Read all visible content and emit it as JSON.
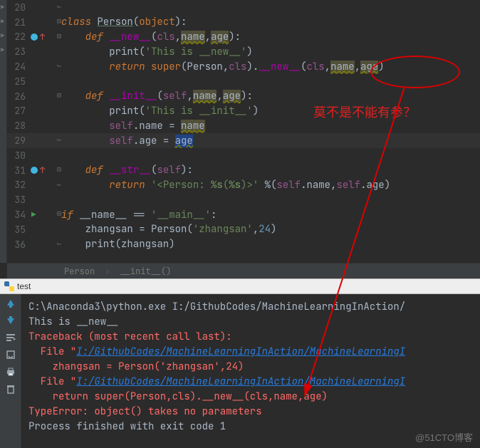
{
  "editor": {
    "lines": [
      {
        "n": 20,
        "gutter": {
          "fold": "end",
          "at": 38
        },
        "segs": []
      },
      {
        "n": 21,
        "gutter": {
          "fold": "start",
          "at": 38
        },
        "segs": [
          {
            "t": "class ",
            "c": "kw"
          },
          {
            "t": "Person",
            "c": "cls"
          },
          {
            "t": "(",
            "c": "op"
          },
          {
            "t": "object",
            "c": "kw2"
          },
          {
            "t": "):",
            "c": "op"
          }
        ]
      },
      {
        "n": 22,
        "gutter": {
          "circle": true,
          "arrowUp": true,
          "fold": "start",
          "at": 38
        },
        "segs": [
          {
            "t": "    ",
            "c": ""
          },
          {
            "t": "def ",
            "c": "kw"
          },
          {
            "t": "__new__",
            "c": "fnmagic"
          },
          {
            "t": "(",
            "c": "op"
          },
          {
            "t": "cls",
            "c": "paramself"
          },
          {
            "t": ",",
            "c": "op"
          },
          {
            "t": "name",
            "c": "param warn"
          },
          {
            "t": ",",
            "c": "op"
          },
          {
            "t": "age",
            "c": "param warn"
          },
          {
            "t": "):",
            "c": "op"
          }
        ]
      },
      {
        "n": 23,
        "gutter": {},
        "segs": [
          {
            "t": "        ",
            "c": ""
          },
          {
            "t": "print",
            "c": "op"
          },
          {
            "t": "(",
            "c": "op"
          },
          {
            "t": "'This is __new__'",
            "c": "str"
          },
          {
            "t": ")",
            "c": "op"
          }
        ]
      },
      {
        "n": 24,
        "gutter": {
          "fold": "end",
          "at": 38
        },
        "segs": [
          {
            "t": "        ",
            "c": ""
          },
          {
            "t": "return ",
            "c": "kw"
          },
          {
            "t": "super",
            "c": "kw2"
          },
          {
            "t": "(",
            "c": "op"
          },
          {
            "t": "Person",
            "c": "op"
          },
          {
            "t": ",",
            "c": "op"
          },
          {
            "t": "cls",
            "c": "paramself"
          },
          {
            "t": ")",
            "c": "op"
          },
          {
            "t": ".",
            "c": "op"
          },
          {
            "t": "__new__",
            "c": "fnmagic"
          },
          {
            "t": "(",
            "c": "op"
          },
          {
            "t": "cls",
            "c": "paramself"
          },
          {
            "t": ",",
            "c": "op"
          },
          {
            "t": "name",
            "c": "warn"
          },
          {
            "t": ",",
            "c": "op"
          },
          {
            "t": "age",
            "c": "warn"
          },
          {
            "t": ")",
            "c": "op"
          }
        ]
      },
      {
        "n": 25,
        "gutter": {},
        "segs": []
      },
      {
        "n": 26,
        "gutter": {
          "fold": "start",
          "at": 38
        },
        "segs": [
          {
            "t": "    ",
            "c": ""
          },
          {
            "t": "def ",
            "c": "kw"
          },
          {
            "t": "__init__",
            "c": "fnmagic"
          },
          {
            "t": "(",
            "c": "op"
          },
          {
            "t": "self",
            "c": "paramself"
          },
          {
            "t": ",",
            "c": "op"
          },
          {
            "t": "name",
            "c": "param warn"
          },
          {
            "t": ",",
            "c": "op"
          },
          {
            "t": "age",
            "c": "param warn"
          },
          {
            "t": "):",
            "c": "op"
          }
        ]
      },
      {
        "n": 27,
        "gutter": {},
        "segs": [
          {
            "t": "        ",
            "c": ""
          },
          {
            "t": "print",
            "c": "op"
          },
          {
            "t": "(",
            "c": "op"
          },
          {
            "t": "'This is __init__'",
            "c": "str"
          },
          {
            "t": ")",
            "c": "op"
          }
        ]
      },
      {
        "n": 28,
        "gutter": {},
        "segs": [
          {
            "t": "        ",
            "c": ""
          },
          {
            "t": "self",
            "c": "paramself"
          },
          {
            "t": ".name ",
            "c": "op"
          },
          {
            "t": "= ",
            "c": "op"
          },
          {
            "t": "name",
            "c": "param warn"
          }
        ]
      },
      {
        "n": 29,
        "hl": true,
        "gutter": {
          "fold": "end",
          "at": 38
        },
        "segs": [
          {
            "t": "        ",
            "c": ""
          },
          {
            "t": "self",
            "c": "paramself"
          },
          {
            "t": ".age ",
            "c": "op"
          },
          {
            "t": "= ",
            "c": "op"
          },
          {
            "t": "age",
            "c": "param warn cursor-bg"
          }
        ]
      },
      {
        "n": 30,
        "gutter": {},
        "segs": []
      },
      {
        "n": 31,
        "gutter": {
          "circle": true,
          "arrowUp": true,
          "fold": "start",
          "at": 38
        },
        "segs": [
          {
            "t": "    ",
            "c": ""
          },
          {
            "t": "def ",
            "c": "kw"
          },
          {
            "t": "__str__",
            "c": "fnmagic"
          },
          {
            "t": "(",
            "c": "op"
          },
          {
            "t": "self",
            "c": "paramself"
          },
          {
            "t": "):",
            "c": "op"
          }
        ]
      },
      {
        "n": 32,
        "gutter": {
          "fold": "end",
          "at": 38
        },
        "segs": [
          {
            "t": "        ",
            "c": ""
          },
          {
            "t": "return ",
            "c": "kw"
          },
          {
            "t": "'<Person: ",
            "c": "str"
          },
          {
            "t": "%s",
            "c": "strbold"
          },
          {
            "t": "(",
            "c": "str"
          },
          {
            "t": "%s",
            "c": "strbold"
          },
          {
            "t": ")>' ",
            "c": "str"
          },
          {
            "t": "%",
            "c": "op"
          },
          {
            "t": "(",
            "c": "op"
          },
          {
            "t": "self",
            "c": "paramself"
          },
          {
            "t": ".name",
            "c": "op"
          },
          {
            "t": ",",
            "c": "op"
          },
          {
            "t": "self",
            "c": "paramself"
          },
          {
            "t": ".age)",
            "c": "op"
          }
        ]
      },
      {
        "n": 33,
        "gutter": {},
        "segs": []
      },
      {
        "n": 34,
        "gutter": {
          "run": true,
          "fold": "start",
          "at": 38
        },
        "segs": [
          {
            "t": "if ",
            "c": "kw"
          },
          {
            "t": "__name__ ",
            "c": "op"
          },
          {
            "t": "== ",
            "c": "op"
          },
          {
            "t": "'__main__'",
            "c": "str"
          },
          {
            "t": ":",
            "c": "op"
          }
        ]
      },
      {
        "n": 35,
        "gutter": {},
        "segs": [
          {
            "t": "    zhangsan ",
            "c": "op"
          },
          {
            "t": "= ",
            "c": "op"
          },
          {
            "t": "Person",
            "c": "op"
          },
          {
            "t": "(",
            "c": "op"
          },
          {
            "t": "'zhangsan'",
            "c": "str"
          },
          {
            "t": ",",
            "c": "op"
          },
          {
            "t": "24",
            "c": "num"
          },
          {
            "t": ")",
            "c": "op"
          }
        ]
      },
      {
        "n": 36,
        "gutter": {
          "fold": "end",
          "at": 38
        },
        "segs": [
          {
            "t": "    ",
            "c": ""
          },
          {
            "t": "print",
            "c": "op"
          },
          {
            "t": "(zhangsan)",
            "c": "op"
          }
        ]
      }
    ]
  },
  "breadcrumb": {
    "cls": "Person",
    "fn": "__init__()"
  },
  "tab": {
    "label": "test"
  },
  "console": {
    "lines": [
      {
        "segs": [
          {
            "t": "C:\\Anaconda3\\python.exe I:/GithubCodes/MachineLearningInAction/",
            "c": ""
          }
        ]
      },
      {
        "segs": [
          {
            "t": "This is __new__",
            "c": ""
          }
        ]
      },
      {
        "segs": [
          {
            "t": "Traceback (most recent call last):",
            "c": "err"
          }
        ]
      },
      {
        "segs": [
          {
            "t": "  File \"",
            "c": "err"
          },
          {
            "t": "I:/GithubCodes/MachineLearningInAction/MachineLearningI",
            "c": "errlink"
          }
        ]
      },
      {
        "segs": [
          {
            "t": "    zhangsan = Person('zhangsan',24)",
            "c": "err"
          }
        ]
      },
      {
        "segs": [
          {
            "t": "  File \"",
            "c": "err"
          },
          {
            "t": "I:/GithubCodes/MachineLearningInAction/MachineLearningI",
            "c": "errlink"
          }
        ]
      },
      {
        "segs": [
          {
            "t": "    return super(Person,cls).__new__(cls,name,age)",
            "c": "err"
          }
        ]
      },
      {
        "segs": [
          {
            "t": "TypeError: object() takes no parameters",
            "c": "err"
          }
        ]
      },
      {
        "segs": [
          {
            "t": "",
            "c": ""
          }
        ]
      },
      {
        "segs": [
          {
            "t": "Process finished with exit code 1",
            "c": ""
          }
        ]
      }
    ]
  },
  "annotation_text": "莫不是不能有参？",
  "watermark": "@51CTO博客"
}
